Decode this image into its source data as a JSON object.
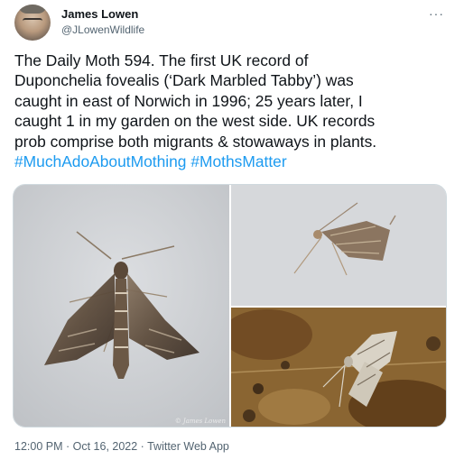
{
  "author": {
    "name": "James Lowen",
    "handle": "@JLowenWildlife"
  },
  "more_icon": "···",
  "tweet": {
    "lines": [
      "The Daily Moth 594. The first UK record of",
      "Duponchelia fovealis (‘Dark Marbled Tabby’) was",
      "caught in east of Norwich in 1996; 25 years later, I",
      "caught 1 in my garden on the west side. UK records",
      "prob comprise both migrants & stowaways in plants."
    ],
    "hashtags": [
      "#MuchAdoAboutMothing",
      "#MothsMatter"
    ]
  },
  "media": {
    "watermark": "© James Lowen"
  },
  "meta": {
    "time": "12:00 PM",
    "separator": " · ",
    "date": "Oct 16, 2022",
    "source": "Twitter Web App"
  },
  "colors": {
    "link": "#1d9bf0",
    "secondary_text": "#536471",
    "primary_text": "#0f1419"
  }
}
